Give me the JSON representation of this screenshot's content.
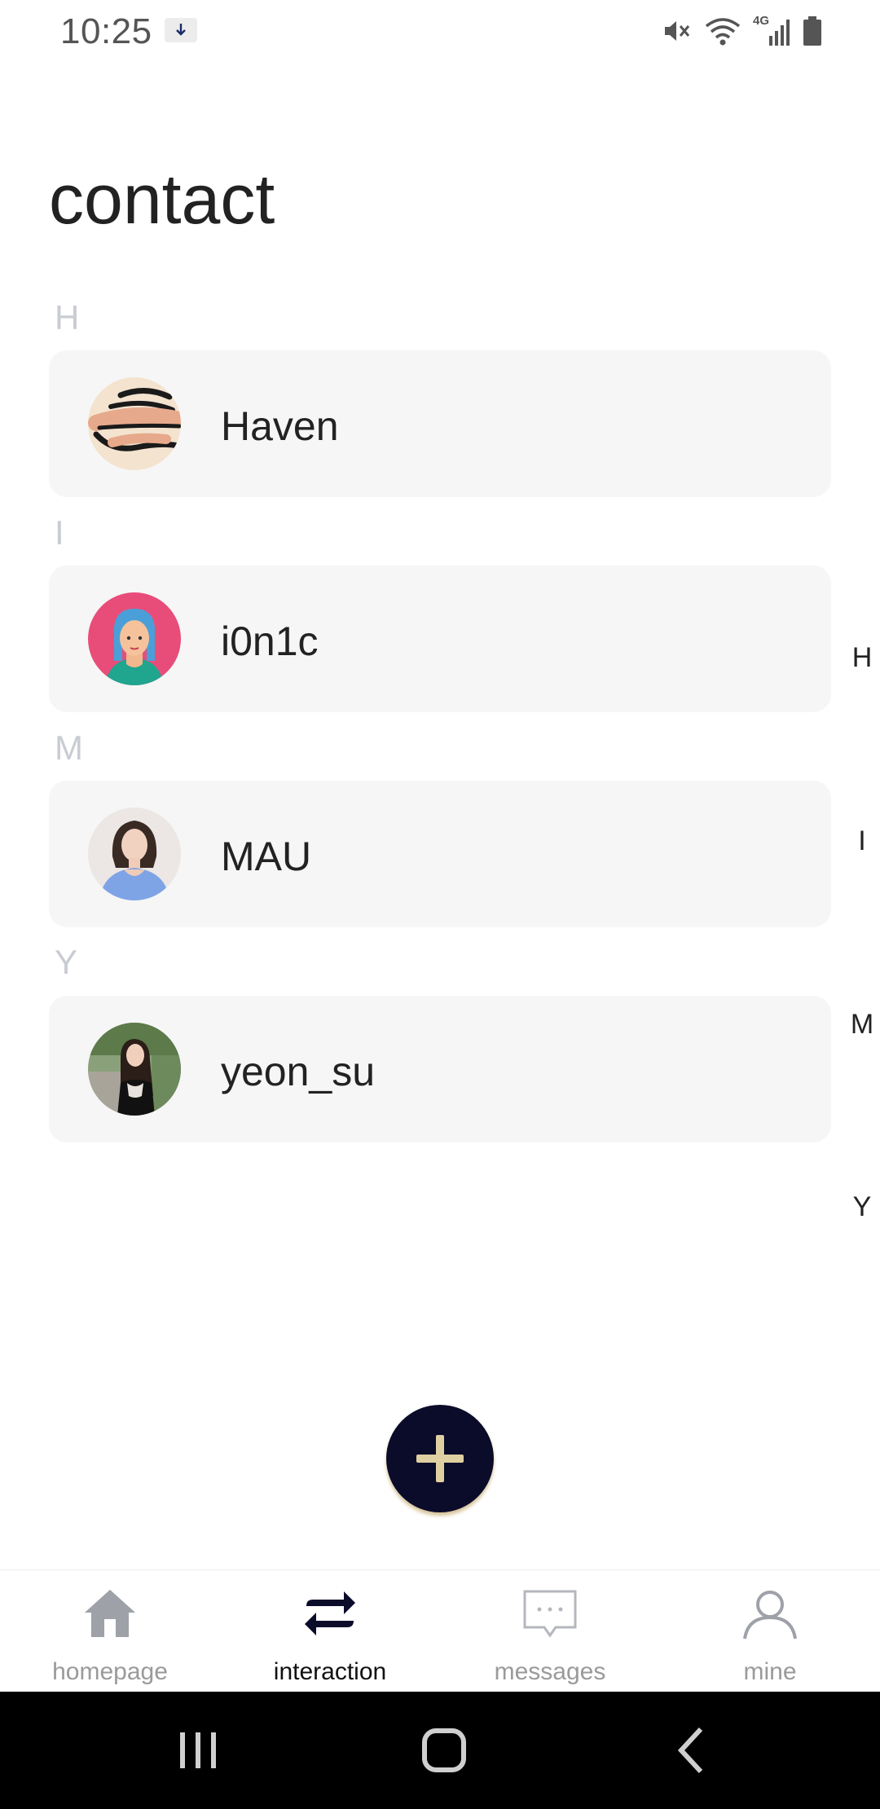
{
  "status_bar": {
    "time": "10:25",
    "icons": [
      "download-notification-icon",
      "mute-icon",
      "wifi-icon",
      "4g-signal-icon",
      "battery-icon"
    ],
    "network_label": "4G"
  },
  "page": {
    "title": "contact"
  },
  "sections": [
    {
      "letter": "H",
      "contacts": [
        {
          "name": "Haven",
          "avatar": "brush-stroke-avatar"
        }
      ]
    },
    {
      "letter": "I",
      "contacts": [
        {
          "name": "i0n1c",
          "avatar": "cartoon-blue-hair-avatar"
        }
      ]
    },
    {
      "letter": "M",
      "contacts": [
        {
          "name": "MAU",
          "avatar": "photo-woman-blue-top-avatar"
        }
      ]
    },
    {
      "letter": "Y",
      "contacts": [
        {
          "name": "yeon_su",
          "avatar": "photo-woman-outdoor-avatar"
        }
      ]
    }
  ],
  "alphabet_index": [
    "H",
    "I",
    "M",
    "Y"
  ],
  "fab": {
    "icon": "plus-icon"
  },
  "tabs": [
    {
      "label": "homepage",
      "icon": "home-icon",
      "active": false
    },
    {
      "label": "interaction",
      "icon": "swap-arrows-icon",
      "active": true
    },
    {
      "label": "messages",
      "icon": "chat-bubble-icon",
      "active": false
    },
    {
      "label": "mine",
      "icon": "user-icon",
      "active": false
    }
  ],
  "system_nav": [
    "recent-apps-icon",
    "home-button-icon",
    "back-icon"
  ],
  "colors": {
    "fab_background": "#0b0b2a",
    "fab_plus": "#e0cfa0",
    "card_background": "#f6f6f6",
    "section_letter": "#c9ccd3",
    "tab_inactive": "#9a9a9a",
    "tab_active": "#111111"
  }
}
